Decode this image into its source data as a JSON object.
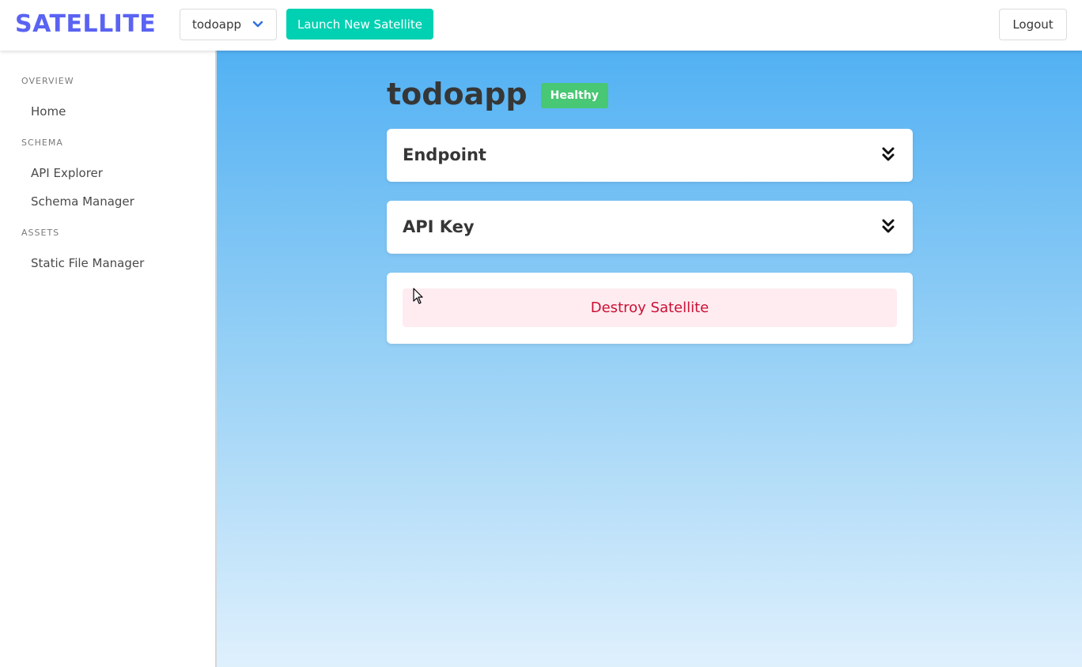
{
  "header": {
    "logo": "SATELLITE",
    "app_selector_value": "todoapp",
    "launch_label": "Launch New Satellite",
    "logout_label": "Logout"
  },
  "sidebar": {
    "sections": [
      {
        "label": "OVERVIEW",
        "items": [
          {
            "label": "Home"
          }
        ]
      },
      {
        "label": "SCHEMA",
        "items": [
          {
            "label": "API Explorer"
          },
          {
            "label": "Schema Manager"
          }
        ]
      },
      {
        "label": "ASSETS",
        "items": [
          {
            "label": "Static File Manager"
          }
        ]
      }
    ]
  },
  "main": {
    "app_name": "todoapp",
    "status": "Healthy",
    "cards": [
      {
        "title": "Endpoint"
      },
      {
        "title": "API Key"
      }
    ],
    "destroy_label": "Destroy Satellite"
  },
  "colors": {
    "brand": "#5a63f2",
    "primary": "#00d1b2",
    "success": "#48c774",
    "danger": "#cc0f35",
    "danger_light": "#feecf0"
  },
  "icons": {
    "app_selector": "chevron-down-icon",
    "card_toggle": "double-chevron-down-icon"
  }
}
